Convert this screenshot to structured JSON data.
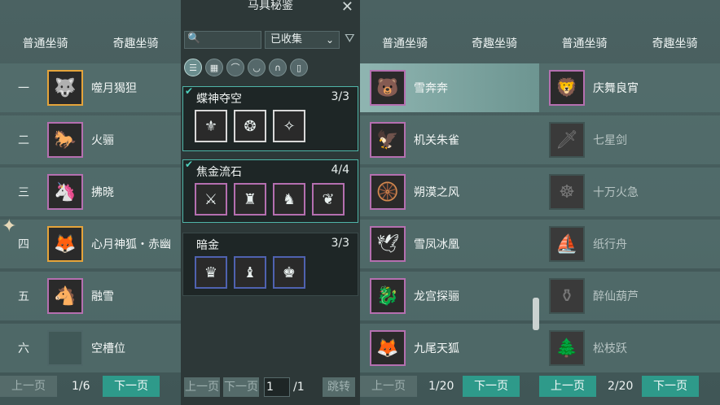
{
  "panel1": {
    "tabs": [
      "普通坐骑",
      "奇趣坐骑"
    ],
    "rows": [
      {
        "num": "一",
        "name": "噬月猲狚",
        "icon": "white-wolf-icon",
        "frame": "gold"
      },
      {
        "num": "二",
        "name": "火骊",
        "icon": "dark-horse-icon",
        "frame": "purple"
      },
      {
        "num": "三",
        "name": "拂晓",
        "icon": "red-unicorn-icon",
        "frame": "purple"
      },
      {
        "num": "四",
        "name": "心月神狐・赤幽",
        "icon": "fox-icon",
        "frame": "gold"
      },
      {
        "num": "五",
        "name": "融雪",
        "icon": "white-horse-icon",
        "frame": "purple"
      },
      {
        "num": "六",
        "name": "空槽位",
        "icon": "empty-slot-icon",
        "frame": "empty"
      }
    ],
    "pager": {
      "prev": "上一页",
      "page": "1/6",
      "next": "下一页"
    }
  },
  "panel2": {
    "title": "马具秘鉴",
    "dropdown": "已收集",
    "cards": [
      {
        "title": "蝶神夺空",
        "count": "3/3",
        "done": true,
        "items": 3
      },
      {
        "title": "焦金流石",
        "count": "4/4",
        "done": true,
        "items": 4
      },
      {
        "title": "暗金",
        "count": "3/3",
        "done": false,
        "items": 3
      }
    ],
    "pager": {
      "prev": "上一页",
      "next": "下一页",
      "page": "1",
      "total": "/1",
      "jump": "跳转"
    }
  },
  "panel3": {
    "tabs": [
      "普通坐骑",
      "奇趣坐骑"
    ],
    "rows": [
      {
        "name": "雪奔奔",
        "icon": "snow-beast-icon",
        "selected": true
      },
      {
        "name": "机关朱雀",
        "icon": "mech-bird-icon"
      },
      {
        "name": "朔漠之风",
        "icon": "chariot-icon"
      },
      {
        "name": "雪凤冰凰",
        "icon": "ice-phoenix-icon"
      },
      {
        "name": "龙宫探骊",
        "icon": "dragon-icon"
      },
      {
        "name": "九尾天狐",
        "icon": "nine-tail-fox-icon"
      }
    ],
    "pager": {
      "prev": "上一页",
      "page": "1/20",
      "next": "下一页"
    }
  },
  "panel4": {
    "tabs": [
      "普通坐骑",
      "奇趣坐骑"
    ],
    "rows": [
      {
        "name": "庆舞良宵",
        "icon": "lion-dance-icon",
        "dim": false
      },
      {
        "name": "七星剑",
        "icon": "sword-icon",
        "dim": true
      },
      {
        "name": "十万火急",
        "icon": "fire-wheel-icon",
        "dim": true
      },
      {
        "name": "纸行舟",
        "icon": "paper-boat-icon",
        "dim": true
      },
      {
        "name": "醉仙葫芦",
        "icon": "gourd-icon",
        "dim": true
      },
      {
        "name": "松枝跃",
        "icon": "pine-branch-icon",
        "dim": true
      }
    ],
    "pager": {
      "prev": "上一页",
      "page": "2/20",
      "next": "下一页"
    }
  }
}
